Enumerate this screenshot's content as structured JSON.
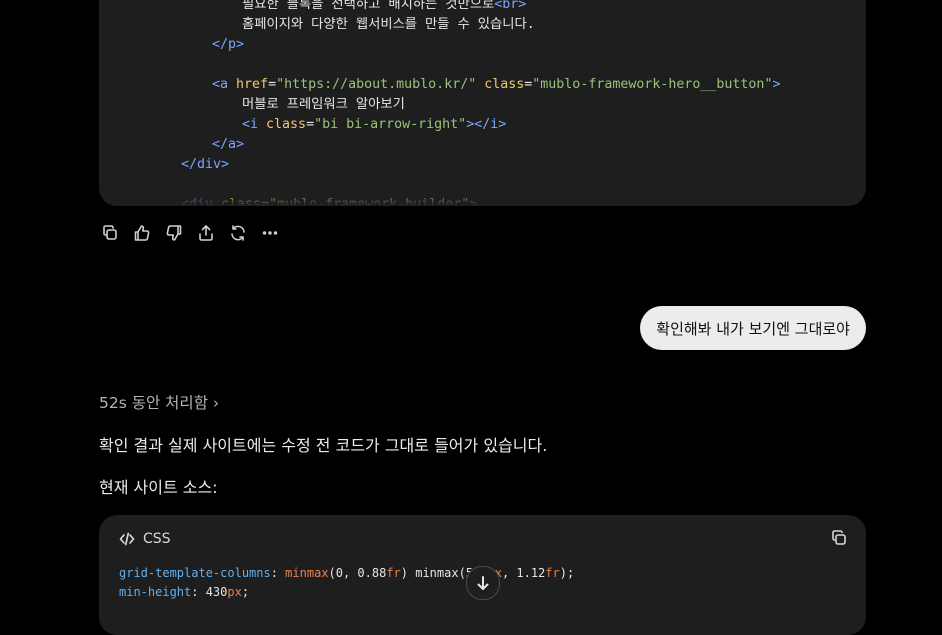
{
  "top_code": {
    "lines": [
      {
        "parts": [
          {
            "t": "필요한 블록을 선택하고 배치하는 것만으로",
            "c": "txt"
          },
          {
            "t": "<br>",
            "c": "tag"
          }
        ]
      },
      {
        "parts": [
          {
            "t": "홈페이지와 다양한 웹서비스를 만들 수 있습니다.",
            "c": "txt"
          }
        ]
      },
      {
        "parts": [
          {
            "t": "</p>",
            "c": "tag"
          }
        ]
      },
      {
        "parts": []
      },
      {
        "parts": [
          {
            "t": "<a ",
            "c": "tag"
          },
          {
            "t": "href",
            "c": "attr"
          },
          {
            "t": "=",
            "c": "txt"
          },
          {
            "t": "\"https://about.mublo.kr/\"",
            "c": "str"
          },
          {
            "t": " ",
            "c": "txt"
          },
          {
            "t": "class",
            "c": "attr"
          },
          {
            "t": "=",
            "c": "txt"
          },
          {
            "t": "\"mublo-framework-hero__button\"",
            "c": "str"
          },
          {
            "t": ">",
            "c": "tag"
          }
        ]
      },
      {
        "parts": [
          {
            "t": "머블로 프레임워크 알아보기",
            "c": "txt"
          }
        ]
      },
      {
        "parts": [
          {
            "t": "<i ",
            "c": "tag"
          },
          {
            "t": "class",
            "c": "attr"
          },
          {
            "t": "=",
            "c": "txt"
          },
          {
            "t": "\"bi bi-arrow-right\"",
            "c": "str"
          },
          {
            "t": "></i>",
            "c": "tag"
          }
        ]
      },
      {
        "parts": [
          {
            "t": "</a>",
            "c": "tag"
          }
        ]
      },
      {
        "parts": [
          {
            "t": "</div>",
            "c": "tag"
          }
        ]
      },
      {
        "parts": []
      },
      {
        "parts": [
          {
            "t": "<div ",
            "c": "tag"
          },
          {
            "t": "class",
            "c": "attr"
          },
          {
            "t": "=",
            "c": "txt"
          },
          {
            "t": "\"mublo-framework-builder\"",
            "c": "str"
          },
          {
            "t": ">",
            "c": "tag"
          }
        ]
      }
    ]
  },
  "actions": [
    "copy-icon",
    "thumbs-up-icon",
    "thumbs-down-icon",
    "share-icon",
    "regenerate-icon",
    "more-icon"
  ],
  "user_message": "확인해봐 내가 보기엔 그대로야",
  "thought_label": "52s 동안 처리함 ›",
  "answer": {
    "para1": "확인 결과 실제 사이트에는 수정 전 코드가 그대로 들어가 있습니다.",
    "para2": "현재 사이트 소스:"
  },
  "bottom_code": {
    "language": "CSS",
    "lines": [
      {
        "parts": [
          {
            "t": "grid-template-columns",
            "c": "prop"
          },
          {
            "t": ": ",
            "c": "txt"
          },
          {
            "t": "minmax",
            "c": "fn"
          },
          {
            "t": "(0, 0.88",
            "c": "txt"
          },
          {
            "t": "fr",
            "c": "unit"
          },
          {
            "t": ") minmax(500",
            "c": "txt"
          },
          {
            "t": "px",
            "c": "unit"
          },
          {
            "t": ", 1.12",
            "c": "txt"
          },
          {
            "t": "fr",
            "c": "unit"
          },
          {
            "t": ");",
            "c": "txt"
          }
        ]
      },
      {
        "parts": [
          {
            "t": "min-height",
            "c": "prop"
          },
          {
            "t": ": 430",
            "c": "txt"
          },
          {
            "t": "px",
            "c": "unit"
          },
          {
            "t": ";",
            "c": "txt"
          }
        ]
      }
    ]
  }
}
